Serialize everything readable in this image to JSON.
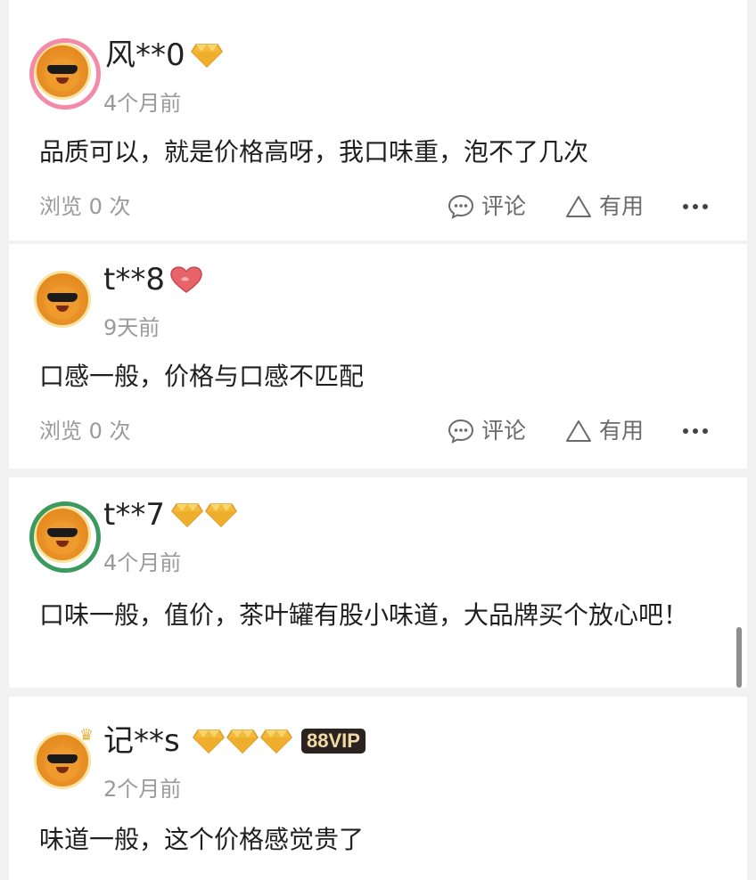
{
  "comments": [
    {
      "username": "风**0",
      "time": "4个月前",
      "content": "品质可以，就是价格高呀，我口味重，泡不了几次",
      "views": "浏览 0 次",
      "reply_label": "评论",
      "useful_label": "有用"
    },
    {
      "username": "t**8",
      "time": "9天前",
      "content": "口感一般，价格与口感不匹配",
      "views": "浏览 0 次",
      "reply_label": "评论",
      "useful_label": "有用"
    },
    {
      "username": "t**7",
      "time": "4个月前",
      "content": "口味一般，值价，茶叶罐有股小味道，大品牌买个放心吧！"
    },
    {
      "username": "记**s",
      "time": "2个月前",
      "vip_badge": "88VIP",
      "content": "味道一般，这个价格感觉贵了"
    }
  ],
  "colors": {
    "diamond": "#f2b93b",
    "heart": "#e7646b",
    "muted_text": "#9a9a9a",
    "vip_bg": "#2a2320",
    "vip_text": "#f1d9a6"
  }
}
